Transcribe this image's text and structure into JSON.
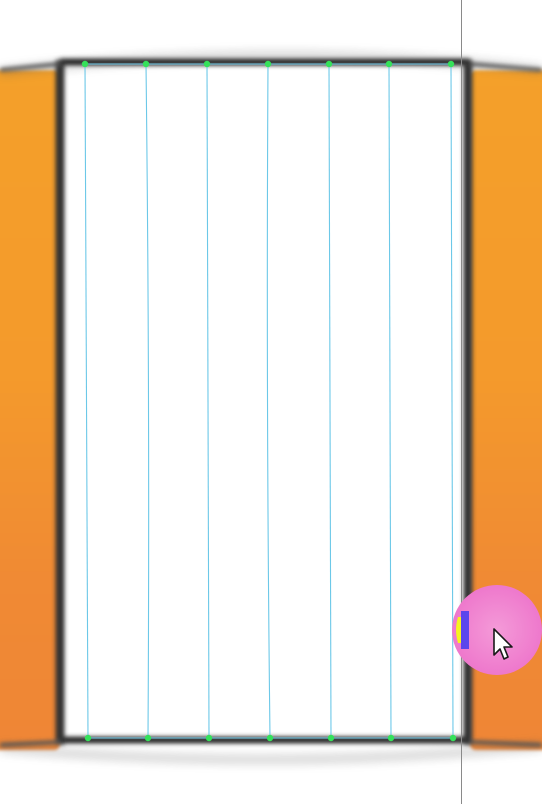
{
  "canvas": {
    "background_color": "#ffffff",
    "panel_color": "#f49a2c",
    "frame_color": "#2b2b2b",
    "path_color": "#6cc8e8",
    "anchor_color": "#35e05a",
    "guide_color": "#8a8a8a"
  },
  "cursor": {
    "icon": "arrow-pointer-icon",
    "highlight_colors": [
      "#f7f21f",
      "#f07fd0",
      "#4a3ff0"
    ]
  }
}
